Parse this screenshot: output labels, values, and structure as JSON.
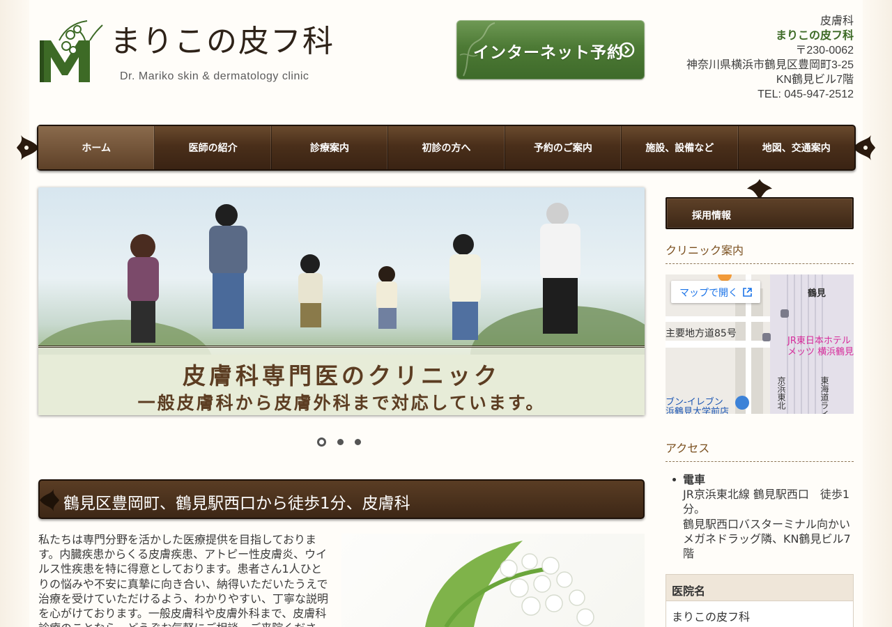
{
  "header": {
    "logo_text": "まりこの皮フ科",
    "logo_sub": "Dr. Mariko skin & dermatology clinic",
    "reserve_label": "インターネット予約",
    "address": {
      "category": "皮膚科",
      "clinic_name": "まりこの皮フ科",
      "postal": "〒230-0062",
      "line1": "神奈川県横浜市鶴見区豊岡町3-25",
      "line2": "KN鶴見ビル7階",
      "tel": "TEL: 045-947-2512"
    }
  },
  "nav": {
    "items": [
      {
        "label": "ホーム"
      },
      {
        "label": "医師の紹介"
      },
      {
        "label": "診療案内"
      },
      {
        "label": "初診の方へ"
      },
      {
        "label": "予約のご案内"
      },
      {
        "label": "施設、設備など"
      },
      {
        "label": "地図、交通案内"
      }
    ]
  },
  "hero": {
    "title": "皮膚科専門医のクリニック",
    "subtitle": "一般皮膚科から皮膚外科まで対応しています。"
  },
  "section": {
    "title": "鶴見区豊岡町、鶴見駅西口から徒歩1分、皮膚科",
    "body": "私たちは専門分野を活かした医療提供を目指しております。内臓疾患からくる皮膚疾患、アトピー性皮膚炎、ウイルス性疾患を特に得意としております。患者さん1人ひとりの悩みや不安に真摯に向き合い、納得いただいたうえで治療を受けていただけるよう、わかりやすい、丁寧な説明を心がけております。一般皮膚科や皮膚外科まで、皮膚科診療のことなら、どうぞお気軽にご相談、ご来院ください。"
  },
  "sidebar": {
    "recruit_label": "採用情報",
    "clinic_heading": "クリニック案内",
    "map": {
      "open_label": "マップで開く",
      "labels": {
        "station": "鶴見",
        "road": "主要地方道85号",
        "hotel1": "JR東日本ホテル",
        "hotel2": "メッツ 横浜鶴見",
        "store1": "ブン-イレブン",
        "store2": "浜鶴見大学前店",
        "line1": "京浜東北",
        "line2": "東海道ライン"
      }
    },
    "access_heading": "アクセス",
    "access": {
      "label": "電車",
      "line1": "JR京浜東北線 鶴見駅西口　徒歩1分。",
      "line2": "鶴見駅西口バスターミナル向かいメガネドラッグ隣、KN鶴見ビル7階"
    },
    "info": {
      "head": "医院名",
      "value": "まりこの皮フ科"
    }
  },
  "colors": {
    "brand_brown": "#3d2716",
    "brand_green": "#3d6a26",
    "accent_text": "#7a4f1e"
  }
}
